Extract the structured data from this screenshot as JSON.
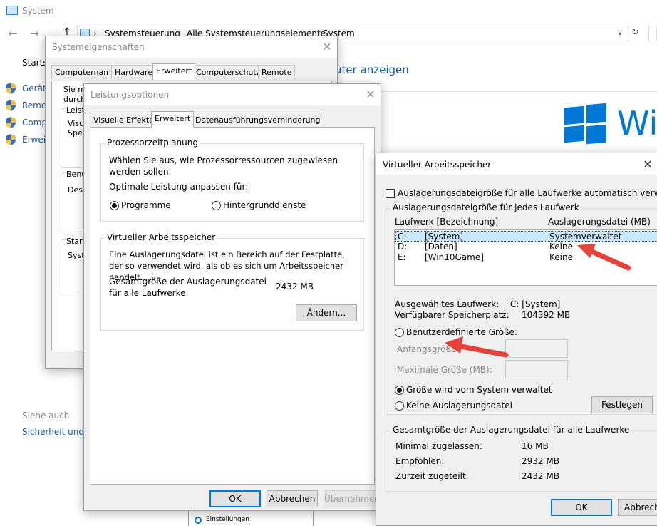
{
  "system": {
    "title": "System",
    "breadcrumb": [
      "Systemsteuerung",
      "Alle Systemsteuerungselemente",
      "System"
    ],
    "left_start": "Startse",
    "left_items": [
      "Geräte",
      "Remot",
      "Comp",
      "Erweit"
    ],
    "see_also": "Siehe auch",
    "security_link": "Sicherheit und W",
    "view_link": "uter anzeigen",
    "brand_text": "Wi",
    "settings_item": "Einstellungen"
  },
  "sysprops": {
    "title": "Systemeigenschaften",
    "tabs": [
      "Computername",
      "Hardware",
      "Erweitert",
      "Computerschutz",
      "Remote"
    ],
    "fragments": [
      "Sie mü",
      "durchf",
      "Leistu",
      "Visue",
      "Speic",
      "Benu",
      "Desk",
      "Starte",
      "Syste"
    ]
  },
  "perf": {
    "title": "Leistungsoptionen",
    "tabs": [
      "Visuelle Effekte",
      "Erweitert",
      "Datenausführungsverhinderung"
    ],
    "cpu_group": "Prozessorzeitplanung",
    "cpu_desc": "Wählen Sie aus, wie Prozessorressourcen zugewiesen werden sollen.",
    "optimize_label": "Optimale Leistung anpassen für:",
    "radio_programs": "Programme",
    "radio_services": "Hintergrunddienste",
    "vm_group": "Virtueller Arbeitsspeicher",
    "vm_desc": "Eine Auslagerungsdatei ist ein Bereich auf der Festplatte, der so verwendet wird, als ob es sich um Arbeitsspeicher handelt.",
    "total_label": "Gesamtgröße der Auslagerungsdatei für alle Laufwerke:",
    "total_value": "2432 MB",
    "change_button": "Ändern...",
    "ok": "OK",
    "cancel": "Abbrechen",
    "apply": "Übernehmen"
  },
  "vm": {
    "title": "Virtueller Arbeitsspeicher",
    "auto_manage": "Auslagerungsdateigröße für alle Laufwerke automatisch verwalten",
    "per_drive_group": "Auslagerungsdateigröße für jedes Laufwerk",
    "col_drive": "Laufwerk [Bezeichnung]",
    "col_pagefile": "Auslagerungsdatei (MB)",
    "drives": [
      {
        "letter": "C:",
        "label": "[System]",
        "pagefile": "Systemverwaltet"
      },
      {
        "letter": "D:",
        "label": "[Daten]",
        "pagefile": "Keine"
      },
      {
        "letter": "E:",
        "label": "[Win10Game]",
        "pagefile": "Keine"
      }
    ],
    "selected_drive_label": "Ausgewähltes Laufwerk:",
    "selected_drive_value": "C:  [System]",
    "free_space_label": "Verfügbarer Speicherplatz:",
    "free_space_value": "104392 MB",
    "custom_size": "Benutzerdefinierte Größe:",
    "initial_size": "Anfangsgröße",
    "max_size": "Maximale Größe (MB):",
    "system_managed": "Größe wird vom System verwaltet",
    "no_pagefile": "Keine Auslagerungsdatei",
    "set_button": "Festlegen",
    "totals_group": "Gesamtgröße der Auslagerungsdatei für alle Laufwerke",
    "min_label": "Minimal zugelassen:",
    "min_value": "16 MB",
    "recommended_label": "Empfohlen:",
    "recommended_value": "2932 MB",
    "allocated_label": "Zurzeit zugeteilt:",
    "allocated_value": "2432 MB",
    "ok": "OK",
    "cancel": "Abbrech"
  },
  "colors": {
    "accent": "#0078d7",
    "selection": "#cce8ff",
    "arrow": "#e8403b",
    "link": "#1a5aa8"
  }
}
